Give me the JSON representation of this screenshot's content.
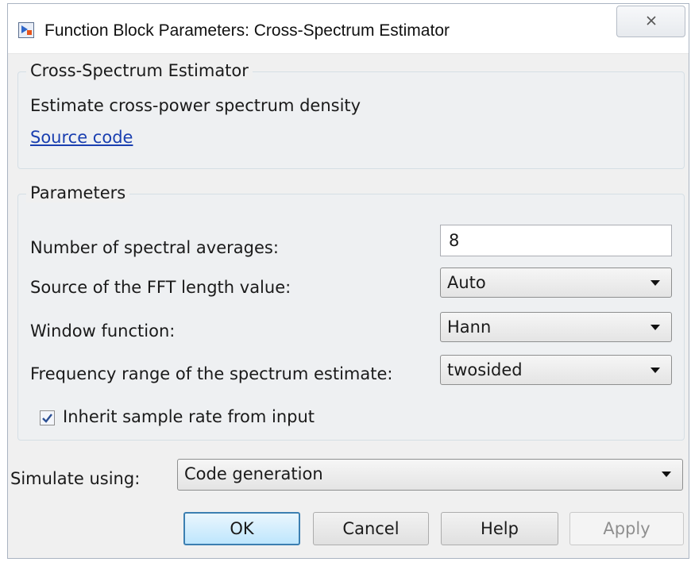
{
  "window": {
    "title": "Function Block Parameters: Cross-Spectrum Estimator"
  },
  "description_group": {
    "legend": "Cross-Spectrum Estimator",
    "text": "Estimate cross-power spectrum density",
    "link": "Source code"
  },
  "parameters": {
    "legend": "Parameters",
    "num_averages": {
      "label": "Number of spectral averages:",
      "value": "8"
    },
    "fft_source": {
      "label": "Source of the FFT length value:",
      "selected": "Auto"
    },
    "window_function": {
      "label": "Window function:",
      "selected": "Hann"
    },
    "frequency_range": {
      "label": "Frequency range of the spectrum estimate:",
      "selected": "twosided"
    },
    "inherit_sample_rate": {
      "label": "Inherit sample rate from input",
      "checked": true
    }
  },
  "simulate": {
    "label": "Simulate using:",
    "selected": "Code generation"
  },
  "buttons": {
    "ok": "OK",
    "cancel": "Cancel",
    "help": "Help",
    "apply": "Apply"
  },
  "colors": {
    "accent": "#3c7fb1",
    "link": "#1a3fb0",
    "dialog_bg": "#f0f0f0"
  }
}
